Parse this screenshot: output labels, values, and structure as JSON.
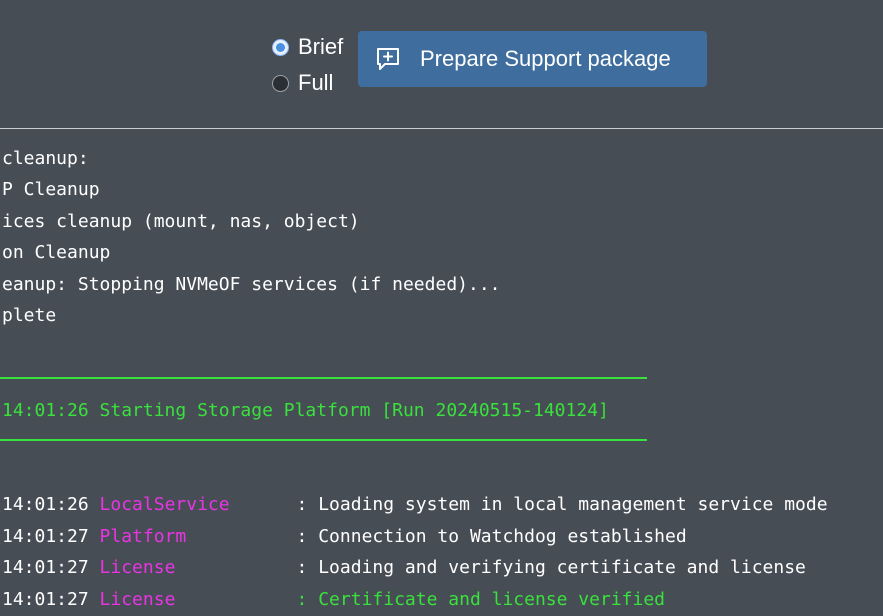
{
  "toolbar": {
    "radio_brief": "Brief",
    "radio_full": "Full",
    "selected": "Brief",
    "support_button": "Prepare Support package",
    "support_icon": "message-plus-icon"
  },
  "log": {
    "cleanup_lines": [
      "cleanup:",
      "P Cleanup",
      "ices cleanup (mount, nas, object)",
      "on Cleanup",
      "eanup: Stopping NVMeOF services (if needed)...",
      "plete"
    ],
    "banner": "14:01:26 Starting Storage Platform [Run 20240515-140124]",
    "entries": [
      {
        "time": "14:01:26",
        "source": "LocalService",
        "message": ": Loading system in local management service mode",
        "message_color": "#ffffff"
      },
      {
        "time": "14:01:27",
        "source": "Platform",
        "message": ": Connection to Watchdog established",
        "message_color": "#ffffff"
      },
      {
        "time": "14:01:27",
        "source": "License",
        "message": ": Loading and verifying certificate and license",
        "message_color": "#ffffff"
      },
      {
        "time": "14:01:27",
        "source": "License",
        "message": ": Certificate and license verified",
        "message_color": "#39e13c"
      }
    ],
    "colors": {
      "banner": "#39e13c",
      "source": "#e934e4",
      "text": "#ffffff"
    }
  }
}
